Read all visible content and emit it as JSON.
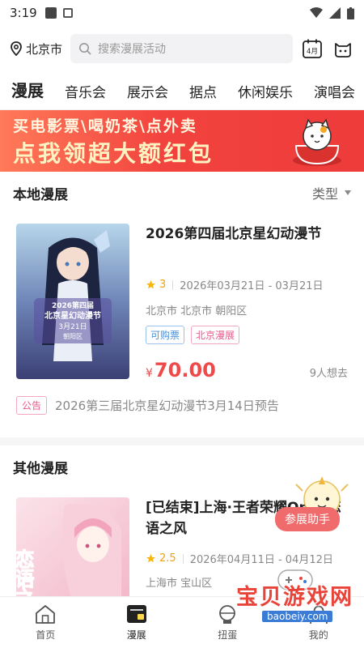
{
  "status": {
    "time": "3:19"
  },
  "header": {
    "city": "北京市",
    "search_placeholder": "搜索漫展活动",
    "calendar_label": "4月"
  },
  "tabs": [
    {
      "label": "漫展"
    },
    {
      "label": "音乐会"
    },
    {
      "label": "展示会"
    },
    {
      "label": "据点"
    },
    {
      "label": "休闲娱乐"
    },
    {
      "label": "演唱会"
    }
  ],
  "banner": {
    "line1": "买电影票\\喝奶茶\\点外卖",
    "line2": "点我领超大额红包"
  },
  "local_section": {
    "title": "本地漫展",
    "filter_label": "类型",
    "event": {
      "title": "2026第四届北京星幻动漫节",
      "score": "3",
      "date": "2026年03月21日 - 03月21日",
      "location": "北京市 北京市 朝阳区",
      "tags": [
        "可购票",
        "北京漫展"
      ],
      "price_symbol": "¥",
      "price": "70.00",
      "want": "9人想去",
      "poster_text": [
        "2026第四届",
        "北京星幻动漫节",
        "3月21日",
        "朝阳区"
      ]
    },
    "notice": {
      "tag": "公告",
      "text": "2026第三届北京星幻动漫节3月14日预告"
    }
  },
  "other_section": {
    "title": "其他漫展",
    "event": {
      "title": "[已结束]上海·王者荣耀Only·恋语之风",
      "score": "2.5",
      "date": "2026年04月11日 - 04月12日",
      "location": "上海市 宝山区",
      "poster_text": "恋语之风"
    }
  },
  "helper": {
    "label": "参展助手"
  },
  "bottom_nav": [
    {
      "label": "首页"
    },
    {
      "label": "漫展"
    },
    {
      "label": "扭蛋"
    },
    {
      "label": "我的"
    }
  ],
  "watermark": {
    "main": "宝贝游戏网",
    "sub": "baobeiy.com"
  },
  "colors": {
    "accent": "#ffd84a",
    "price": "#ef4a4a",
    "banner": "#f2433e",
    "tag_pink": "#e85a8b",
    "tag_blue": "#4a90d9"
  }
}
